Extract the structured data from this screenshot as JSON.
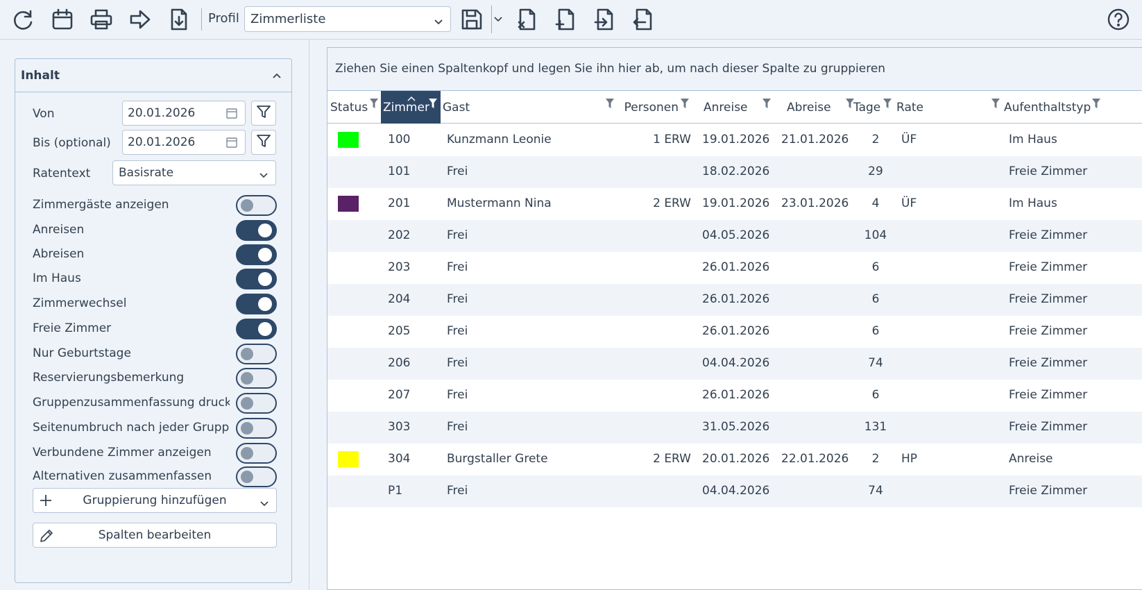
{
  "toolbar": {
    "profil_label": "Profil",
    "profil_value": "Zimmerliste",
    "buttons": [
      "refresh-icon",
      "calendar-icon",
      "print-icon",
      "forward-icon",
      "download-icon",
      "save-icon",
      "remove-file-icon",
      "add-file-icon",
      "import-icon",
      "export-icon",
      "help-icon"
    ]
  },
  "panel": {
    "title": "Inhalt",
    "von_label": "Von",
    "von_value": "20.01.2026",
    "bis_label": "Bis (optional)",
    "bis_value": "20.01.2026",
    "ratentext_label": "Ratentext",
    "ratentext_value": "Basisrate",
    "toggles": [
      {
        "label": "Zimmergäste anzeigen",
        "on": false
      },
      {
        "label": "Anreisen",
        "on": true
      },
      {
        "label": "Abreisen",
        "on": true
      },
      {
        "label": "Im Haus",
        "on": true
      },
      {
        "label": "Zimmerwechsel",
        "on": true
      },
      {
        "label": "Freie Zimmer",
        "on": true
      },
      {
        "label": "Nur Geburtstage",
        "on": false
      },
      {
        "label": "Reservierungsbemerkung",
        "on": false
      },
      {
        "label": "Gruppenzusammenfassung drucken",
        "on": false
      },
      {
        "label": "Seitenumbruch nach jeder Gruppe",
        "on": false
      },
      {
        "label": "Verbundene Zimmer anzeigen",
        "on": false
      },
      {
        "label": "Alternativen zusammenfassen",
        "on": false
      }
    ],
    "add_grouping_label": "Gruppierung hinzufügen",
    "edit_columns_label": "Spalten bearbeiten"
  },
  "grid": {
    "group_hint": "Ziehen Sie einen Spaltenkopf und legen Sie ihn hier ab, um nach dieser Spalte zu gruppieren",
    "columns": [
      "Status",
      "Zimmer",
      "Gast",
      "Personen",
      "Anreise",
      "Abreise",
      "Tage",
      "Rate",
      "Aufenthaltstyp"
    ],
    "rows": [
      {
        "status_color": "#00ff00",
        "zimmer": "100",
        "gast": "Kunzmann Leonie",
        "personen": "1 ERW",
        "anreise": "19.01.2026",
        "abreise": "21.01.2026",
        "tage": "2",
        "rate": "ÜF",
        "typ": "Im Haus"
      },
      {
        "status_color": "",
        "zimmer": "101",
        "gast": "Frei",
        "personen": "",
        "anreise": "18.02.2026",
        "abreise": "",
        "tage": "29",
        "rate": "",
        "typ": "Freie Zimmer"
      },
      {
        "status_color": "#5a2166",
        "zimmer": "201",
        "gast": "Mustermann Nina",
        "personen": "2 ERW",
        "anreise": "19.01.2026",
        "abreise": "23.01.2026",
        "tage": "4",
        "rate": "ÜF",
        "typ": "Im Haus"
      },
      {
        "status_color": "",
        "zimmer": "202",
        "gast": "Frei",
        "personen": "",
        "anreise": "04.05.2026",
        "abreise": "",
        "tage": "104",
        "rate": "",
        "typ": "Freie Zimmer"
      },
      {
        "status_color": "",
        "zimmer": "203",
        "gast": "Frei",
        "personen": "",
        "anreise": "26.01.2026",
        "abreise": "",
        "tage": "6",
        "rate": "",
        "typ": "Freie Zimmer"
      },
      {
        "status_color": "",
        "zimmer": "204",
        "gast": "Frei",
        "personen": "",
        "anreise": "26.01.2026",
        "abreise": "",
        "tage": "6",
        "rate": "",
        "typ": "Freie Zimmer"
      },
      {
        "status_color": "",
        "zimmer": "205",
        "gast": "Frei",
        "personen": "",
        "anreise": "26.01.2026",
        "abreise": "",
        "tage": "6",
        "rate": "",
        "typ": "Freie Zimmer"
      },
      {
        "status_color": "",
        "zimmer": "206",
        "gast": "Frei",
        "personen": "",
        "anreise": "04.04.2026",
        "abreise": "",
        "tage": "74",
        "rate": "",
        "typ": "Freie Zimmer"
      },
      {
        "status_color": "",
        "zimmer": "207",
        "gast": "Frei",
        "personen": "",
        "anreise": "26.01.2026",
        "abreise": "",
        "tage": "6",
        "rate": "",
        "typ": "Freie Zimmer"
      },
      {
        "status_color": "",
        "zimmer": "303",
        "gast": "Frei",
        "personen": "",
        "anreise": "31.05.2026",
        "abreise": "",
        "tage": "131",
        "rate": "",
        "typ": "Freie Zimmer"
      },
      {
        "status_color": "#ffff00",
        "zimmer": "304",
        "gast": "Burgstaller Grete",
        "personen": "2 ERW",
        "anreise": "20.01.2026",
        "abreise": "22.01.2026",
        "tage": "2",
        "rate": "HP",
        "typ": "Anreise"
      },
      {
        "status_color": "",
        "zimmer": "P1",
        "gast": "Frei",
        "personen": "",
        "anreise": "04.04.2026",
        "abreise": "",
        "tage": "74",
        "rate": "",
        "typ": "Freie Zimmer"
      }
    ]
  },
  "colors": {
    "accent": "#2e4868",
    "toolbar_bg": "#eef3f9",
    "alt_row": "#f0f4f9"
  }
}
